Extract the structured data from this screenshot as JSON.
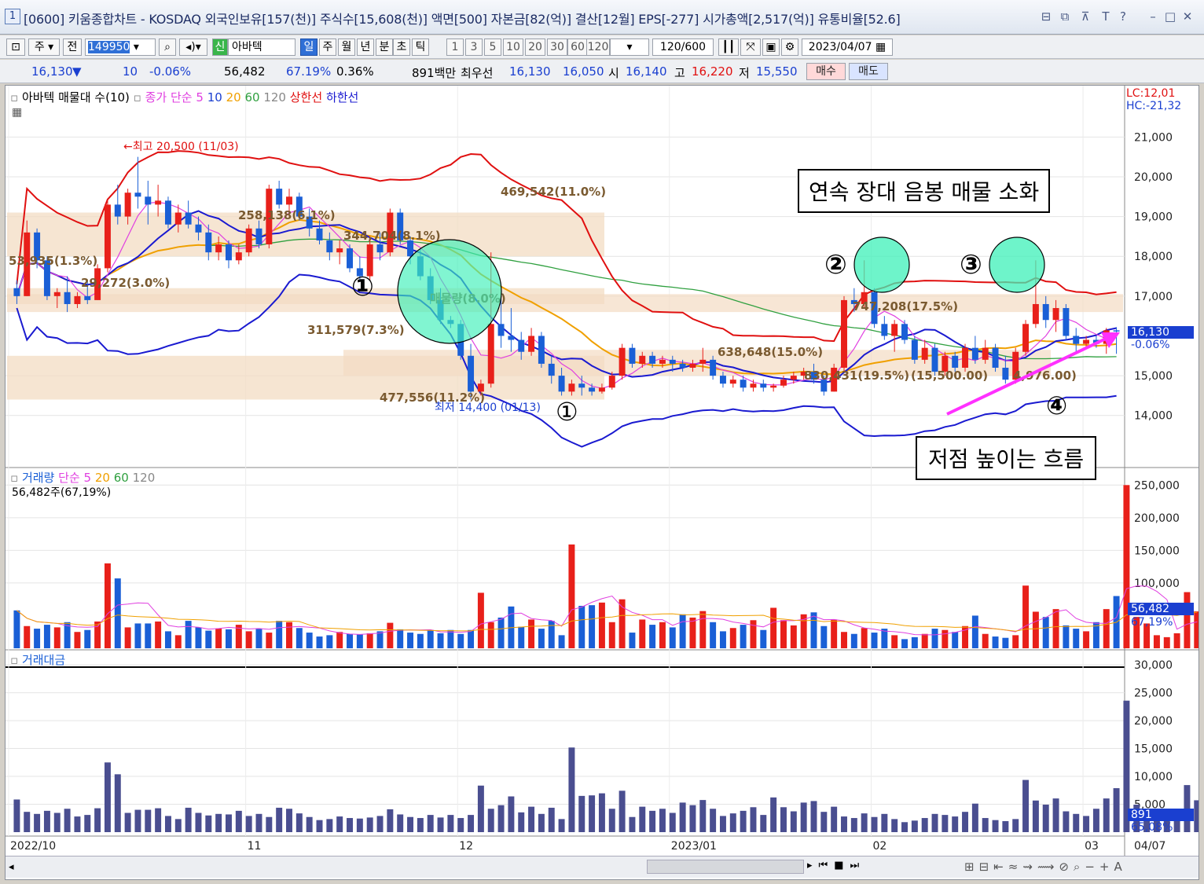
{
  "window": {
    "number": "1",
    "title": "[0600] 키움종합차트 - KOSDAQ 외국인보유[157(천)] 주식수[15,608(천)] 액면[500] 자본금[82(억)] 결산[12월] EPS[-277] 시가총액[2,517(억)] 유통비율[52.6]"
  },
  "toolbar": {
    "type_label": "주",
    "prev_label": "전",
    "code": "149950",
    "shin_label": "신",
    "stock_name": "아바텍",
    "periods": [
      "일",
      "주",
      "월",
      "년",
      "분",
      "초",
      "틱"
    ],
    "active_period": "일",
    "minutes": [
      "1",
      "3",
      "5",
      "10",
      "20",
      "30",
      "60",
      "120"
    ],
    "count": "120",
    "count_max": "/600",
    "date": "2023/04/07"
  },
  "quote": {
    "price": "16,130",
    "arrow": "▼",
    "change": "10",
    "change_pct": "-0.06%",
    "volume": "56,482",
    "volume_ratio": "67.19%",
    "turnover": "0.36%",
    "amount": "891백만",
    "best_label": "최우선",
    "ask": "16,130",
    "bid": "16,050",
    "open_label": "시",
    "open": "16,140",
    "high_label": "고",
    "high": "16,220",
    "low_label": "저",
    "low": "15,550",
    "buy_label": "매수",
    "sell_label": "매도"
  },
  "price_panel": {
    "legend": {
      "name": "아바텍 매물대 수(10)",
      "ma_label": "종가 단순",
      "ma5": "5",
      "ma10": "10",
      "ma20": "20",
      "ma60": "60",
      "ma120": "120",
      "upper": "상한선",
      "lower": "하한선"
    },
    "lc": "LC:12,01",
    "hc": "HC:-21,32",
    "y_ticks": [
      "21,000",
      "20,000",
      "19,000",
      "18,000",
      "17,000",
      "15,000",
      "14,000"
    ],
    "current_price": "16,130",
    "current_pct": "-0.06%",
    "high_note": "최고 20,500 (11/03)",
    "low_note": "최저 14,400 (01/13)",
    "volume_profile_labels": [
      "469,542(11.0%)",
      "258,138(6.1%)",
      "344,704(8.1%)",
      "53,935(1.3%)",
      "29,272(3.0%)",
      "매물량(8.0%)",
      "311,579(7.3%)",
      "638,648(15.0%)",
      "747,208(17.5%)",
      "830,431(19.5%)",
      "(15,500.00)",
      "4,976.00)",
      "477,556(11.2%)"
    ],
    "annotations": {
      "box1": "연속 장대 음봉 매물 소화",
      "box2": "저점 높이는 흐름",
      "marker1": "①",
      "marker2": "②",
      "marker3": "③",
      "marker4": "④"
    }
  },
  "volume_panel": {
    "legend": {
      "name": "거래량",
      "ma_label": "단순",
      "ma5": "5",
      "ma20": "20",
      "ma60": "60",
      "ma120": "120"
    },
    "info": "56,482주(67,19%)",
    "y_ticks": [
      "250,000",
      "200,000",
      "150,000",
      "100,000"
    ],
    "current": "56,482",
    "current_pct": "67,19%"
  },
  "amount_panel": {
    "legend": {
      "name": "거래대금"
    },
    "y_ticks": [
      "30,000",
      "25,000",
      "20,000",
      "15,000",
      "10,000",
      "5,000"
    ],
    "current": "891",
    "current_pct": "65,08%"
  },
  "x_axis": [
    "2022/10",
    "11",
    "12",
    "2023/01",
    "02",
    "03",
    "04",
    "04/07"
  ],
  "colors": {
    "up": "#e8201a",
    "down": "#1a5fd6",
    "upper_band": "#e01010",
    "lower_band": "#1a1ad0",
    "ma5": "#e040e0",
    "ma20": "#f0a000",
    "ma60": "#30a040",
    "circle": "#3ef0b8",
    "arrow": "#ff30ff"
  },
  "chart_data": {
    "type": "candlestick",
    "candles": [
      [
        17200,
        17400,
        16800,
        17000
      ],
      [
        17000,
        18900,
        17000,
        18600
      ],
      [
        18600,
        18700,
        17700,
        17900
      ],
      [
        17900,
        18000,
        16900,
        17000
      ],
      [
        17000,
        17200,
        16700,
        17100
      ],
      [
        17100,
        17500,
        16600,
        16800
      ],
      [
        16800,
        17100,
        16700,
        17000
      ],
      [
        17000,
        17400,
        16800,
        16900
      ],
      [
        16900,
        17800,
        16900,
        17700
      ],
      [
        17700,
        19400,
        17600,
        19300
      ],
      [
        19300,
        19800,
        18800,
        19000
      ],
      [
        19000,
        19700,
        18800,
        19600
      ],
      [
        19600,
        20500,
        19200,
        19500
      ],
      [
        19500,
        19900,
        18800,
        19300
      ],
      [
        19300,
        19800,
        19000,
        19400
      ],
      [
        19400,
        19500,
        18700,
        18800
      ],
      [
        18800,
        19300,
        18600,
        19100
      ],
      [
        19100,
        19400,
        18700,
        18800
      ],
      [
        18800,
        19000,
        18400,
        18600
      ],
      [
        18600,
        18800,
        17900,
        18100
      ],
      [
        18100,
        18500,
        17900,
        18300
      ],
      [
        18300,
        18400,
        17700,
        17900
      ],
      [
        17900,
        18300,
        17800,
        18100
      ],
      [
        18100,
        18800,
        18000,
        18700
      ],
      [
        18700,
        18900,
        18200,
        18300
      ],
      [
        18300,
        19800,
        18200,
        19700
      ],
      [
        19700,
        19900,
        19200,
        19300
      ],
      [
        19300,
        19700,
        19000,
        19500
      ],
      [
        19500,
        19600,
        18900,
        19000
      ],
      [
        19000,
        19200,
        18500,
        18700
      ],
      [
        18700,
        18900,
        18300,
        18400
      ],
      [
        18400,
        18600,
        17900,
        18100
      ],
      [
        18100,
        18400,
        17800,
        18200
      ],
      [
        18200,
        18300,
        17600,
        17700
      ],
      [
        17700,
        18000,
        17400,
        17500
      ],
      [
        17500,
        18500,
        17400,
        18300
      ],
      [
        18300,
        18600,
        17900,
        18100
      ],
      [
        18100,
        19200,
        18000,
        19100
      ],
      [
        19100,
        19200,
        18300,
        18400
      ],
      [
        18400,
        18500,
        17800,
        18000
      ],
      [
        18000,
        18200,
        17400,
        17500
      ],
      [
        17500,
        17700,
        16800,
        16900
      ],
      [
        16900,
        17200,
        16300,
        16400
      ],
      [
        16400,
        16500,
        16200,
        16300
      ],
      [
        16300,
        16400,
        15400,
        15500
      ],
      [
        15500,
        15800,
        14400,
        14600
      ],
      [
        14600,
        14900,
        14500,
        14800
      ],
      [
        14800,
        18100,
        14700,
        16300
      ],
      [
        16300,
        17000,
        15700,
        16000
      ],
      [
        16000,
        16700,
        15600,
        15900
      ],
      [
        15900,
        16100,
        15400,
        15600
      ],
      [
        15600,
        16200,
        15500,
        16000
      ],
      [
        16000,
        16100,
        15200,
        15300
      ],
      [
        15300,
        15500,
        14800,
        15000
      ],
      [
        15000,
        15200,
        14500,
        14600
      ],
      [
        14600,
        14900,
        14500,
        14800
      ],
      [
        14800,
        15000,
        14500,
        14700
      ],
      [
        14700,
        14800,
        14500,
        14600
      ],
      [
        14600,
        14800,
        14550,
        14700
      ],
      [
        14700,
        15100,
        14650,
        15000
      ],
      [
        15000,
        15800,
        14900,
        15700
      ],
      [
        15700,
        15800,
        15200,
        15300
      ],
      [
        15300,
        15600,
        15200,
        15500
      ],
      [
        15500,
        15600,
        15200,
        15300
      ],
      [
        15300,
        15500,
        15200,
        15400
      ],
      [
        15400,
        15500,
        15100,
        15300
      ],
      [
        15300,
        15400,
        15100,
        15200
      ],
      [
        15200,
        15400,
        15100,
        15300
      ],
      [
        15300,
        15700,
        15100,
        15400
      ],
      [
        15400,
        15500,
        14900,
        15000
      ],
      [
        15000,
        15100,
        14700,
        14800
      ],
      [
        14800,
        15000,
        14700,
        14900
      ],
      [
        14900,
        15000,
        14600,
        14700
      ],
      [
        14700,
        14900,
        14600,
        14800
      ],
      [
        14800,
        14900,
        14600,
        14700
      ],
      [
        14700,
        14800,
        14600,
        14750
      ],
      [
        14750,
        15000,
        14700,
        14900
      ],
      [
        14900,
        15100,
        14800,
        15000
      ],
      [
        15000,
        15200,
        14900,
        15100
      ],
      [
        15100,
        15300,
        14800,
        14900
      ],
      [
        14900,
        15000,
        14500,
        14600
      ],
      [
        14600,
        15300,
        14600,
        15200
      ],
      [
        15200,
        17000,
        15100,
        16900
      ],
      [
        16900,
        17200,
        16600,
        16800
      ],
      [
        16800,
        17900,
        16700,
        17100
      ],
      [
        17100,
        17200,
        16200,
        16300
      ],
      [
        16300,
        16500,
        15900,
        16000
      ],
      [
        16000,
        16400,
        15600,
        16300
      ],
      [
        16300,
        16400,
        15800,
        15900
      ],
      [
        15900,
        16000,
        15300,
        15400
      ],
      [
        15400,
        15900,
        15300,
        15700
      ],
      [
        15700,
        15800,
        15000,
        15100
      ],
      [
        15100,
        15600,
        15000,
        15500
      ],
      [
        15500,
        15600,
        15100,
        15200
      ],
      [
        15200,
        15800,
        15100,
        15700
      ],
      [
        15700,
        16000,
        15300,
        15400
      ],
      [
        15400,
        15900,
        15300,
        15700
      ],
      [
        15700,
        15800,
        15100,
        15200
      ],
      [
        15200,
        15500,
        14800,
        14900
      ],
      [
        14900,
        15700,
        14800,
        15600
      ],
      [
        15600,
        16400,
        15500,
        16300
      ],
      [
        16300,
        17900,
        16200,
        16800
      ],
      [
        16800,
        17000,
        16200,
        16400
      ],
      [
        16400,
        16900,
        16100,
        16700
      ],
      [
        16700,
        16800,
        15900,
        16000
      ],
      [
        16000,
        16200,
        15600,
        15800
      ],
      [
        15800,
        16000,
        15700,
        15900
      ],
      [
        15900,
        16000,
        15700,
        15800
      ],
      [
        15800,
        16200,
        15550,
        16140
      ],
      [
        16140,
        16220,
        15550,
        16130
      ]
    ],
    "volumes": [
      58000,
      34000,
      30000,
      36000,
      32000,
      40000,
      25000,
      28000,
      41000,
      130000,
      107000,
      32000,
      38000,
      38000,
      41000,
      26000,
      20000,
      42000,
      32000,
      27000,
      30000,
      29000,
      36000,
      26000,
      30000,
      24000,
      42000,
      40000,
      31000,
      24000,
      18000,
      20000,
      25000,
      22000,
      21000,
      23000,
      26000,
      39000,
      29000,
      24000,
      22000,
      28000,
      23000,
      28000,
      22000,
      28000,
      85000,
      40000,
      47000,
      64000,
      33000,
      44000,
      30000,
      42000,
      20000,
      159000,
      65000,
      66000,
      70000,
      40000,
      75000,
      24000,
      44000,
      36000,
      40000,
      32000,
      52000,
      47000,
      57000,
      40000,
      26000,
      31000,
      36000,
      43000,
      28000,
      62000,
      43000,
      35000,
      52000,
      55000,
      34000,
      44000,
      25000,
      22000,
      31000,
      24000,
      30000,
      20000,
      14000,
      17000,
      22000,
      30000,
      28000,
      25000,
      34000,
      50000,
      22000,
      18000,
      16000,
      20000,
      96000,
      56000,
      48000,
      60000,
      35000,
      30000,
      26000,
      40000,
      60000,
      80000,
      250000,
      48000,
      38000,
      20000,
      17000,
      23000,
      86000,
      56482
    ],
    "x_tick_labels": [
      "2022/10",
      "11",
      "12",
      "2023/01",
      "02",
      "03",
      "04"
    ],
    "y_range": [
      13600,
      21500
    ]
  }
}
